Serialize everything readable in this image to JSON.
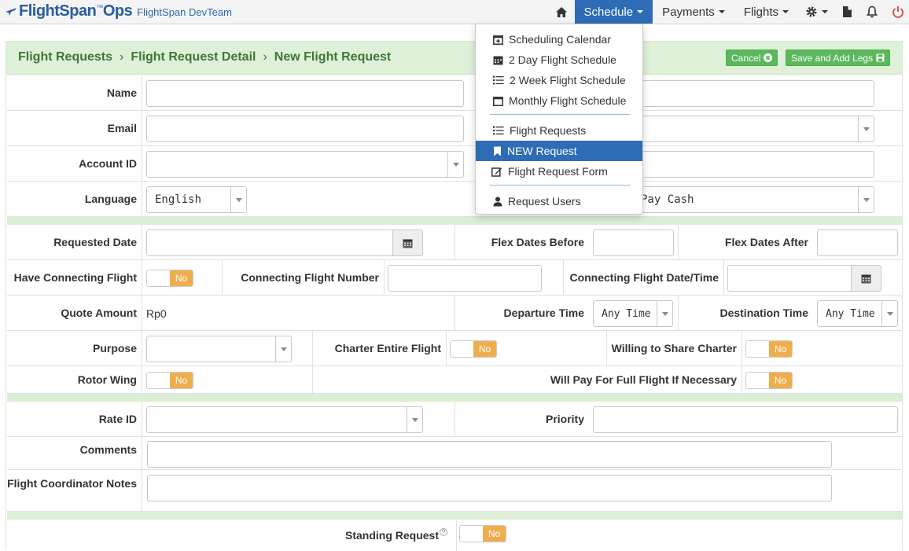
{
  "navbar": {
    "brand": "FlightSpan",
    "brand_ops": "Ops",
    "team": "FlightSpan DevTeam",
    "menus": [
      "Schedule",
      "Payments",
      "Flights"
    ]
  },
  "schedule_menu": {
    "items": [
      "Scheduling Calendar",
      "2 Day Flight Schedule",
      "2 Week Flight Schedule",
      "Monthly Flight Schedule",
      "Flight Requests",
      "NEW Request",
      "Flight Request Form",
      "Request Users"
    ],
    "active": "NEW Request"
  },
  "breadcrumb": [
    "Flight Requests",
    "Flight Request Detail",
    "New Flight Request"
  ],
  "buttons": {
    "cancel": "Cancel",
    "save": "Save and Add Legs"
  },
  "labels": {
    "name": "Name",
    "email": "Email",
    "account_id": "Account ID",
    "language": "Language",
    "requested_date": "Requested Date",
    "flex_before": "Flex Dates Before",
    "flex_after": "Flex Dates After",
    "have_connecting": "Have Connecting Flight",
    "connecting_number": "Connecting Flight Number",
    "connecting_datetime": "Connecting Flight Date/Time",
    "quote_amount": "Quote Amount",
    "departure_time": "Departure Time",
    "destination_time": "Destination Time",
    "purpose": "Purpose",
    "charter_entire": "Charter Entire Flight",
    "willing_share": "Willing to Share Charter",
    "rotor_wing": "Rotor Wing",
    "will_pay_full": "Will Pay For Full Flight If Necessary",
    "rate_id": "Rate ID",
    "priority": "Priority",
    "comments": "Comments",
    "coordinator_notes": "Flight Coordinator Notes",
    "standing_request": "Standing Request"
  },
  "values": {
    "language": "English",
    "payment": "Pay Cash",
    "quote_amount": "Rp0",
    "departure_time": "Any Time",
    "destination_time": "Any Time",
    "toggle_no": "No"
  },
  "colors": {
    "accent": "#2e6cb5",
    "panel_bg": "#dff0d8",
    "toggle_off": "#f0ad4e",
    "btn_green": "#5cb85c"
  }
}
